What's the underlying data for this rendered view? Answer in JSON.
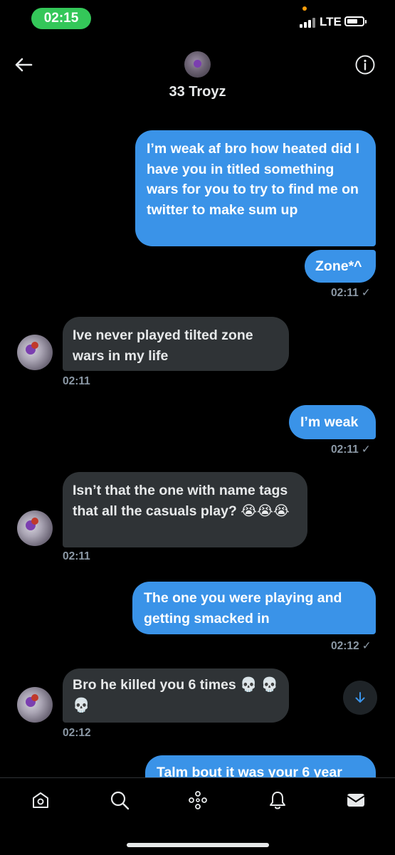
{
  "status_bar": {
    "time": "02:15",
    "network": "LTE"
  },
  "header": {
    "contact_name": "33 Troyz"
  },
  "messages": [
    {
      "side": "out",
      "text": "I’m weak af bro how heated did I have you in titled something wars for you to try to find me on twitter to make sum up"
    },
    {
      "side": "out",
      "text": "Zone*^"
    },
    {
      "side": "out_ts",
      "time": "02:11",
      "check": "✓"
    },
    {
      "side": "in",
      "text": "Ive never played tilted zone wars in my life"
    },
    {
      "side": "in_ts",
      "time": "02:11"
    },
    {
      "side": "out",
      "text": "I’m weak"
    },
    {
      "side": "out_ts",
      "time": "02:11",
      "check": "✓"
    },
    {
      "side": "in",
      "text": "Isn’t that the one with name tags that all the casuals play? 😭😭😭"
    },
    {
      "side": "in_ts",
      "time": "02:11"
    },
    {
      "side": "out",
      "text": "The one you were playing and getting smacked in"
    },
    {
      "side": "out_ts",
      "time": "02:12",
      "check": "✓"
    },
    {
      "side": "in",
      "text": "Bro he killed you 6 times 💀 💀💀"
    },
    {
      "side": "in_ts",
      "time": "02:12"
    },
    {
      "side": "out",
      "text": "Talm bout it was your 6 year"
    }
  ],
  "icons": {
    "back": "arrow-left-icon",
    "info": "info-icon",
    "scroll_down": "arrow-down-icon",
    "nav": [
      "home-icon",
      "search-icon",
      "spaces-icon",
      "bell-icon",
      "mail-icon"
    ]
  },
  "colors": {
    "outgoing_bubble": "#3a93e8",
    "incoming_bubble": "#2f3336",
    "background": "#000000",
    "time_pill": "#34c759"
  }
}
